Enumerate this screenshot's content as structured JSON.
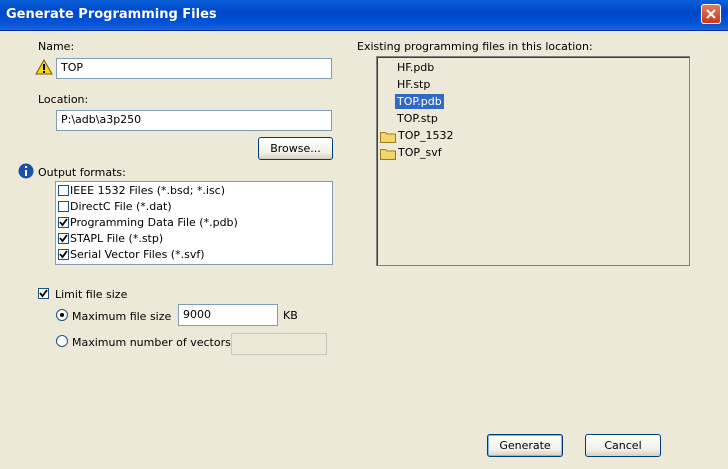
{
  "window": {
    "title": "Generate Programming Files"
  },
  "name": {
    "label": "Name:",
    "value": "TOP"
  },
  "location": {
    "label": "Location:",
    "value": "P:\\adb\\a3p250"
  },
  "browse_label": "Browse...",
  "output": {
    "label": "Output formats:",
    "items": [
      {
        "label": "IEEE 1532 Files (*.bsd; *.isc)",
        "checked": false
      },
      {
        "label": "DirectC File (*.dat)",
        "checked": false
      },
      {
        "label": "Programming Data File (*.pdb)",
        "checked": true
      },
      {
        "label": "STAPL File (*.stp)",
        "checked": true
      },
      {
        "label": "Serial Vector Files (*.svf)",
        "checked": true
      }
    ]
  },
  "existing": {
    "label": "Existing programming files in this location:",
    "items": [
      {
        "label": "HF.pdb",
        "type": "file",
        "selected": false
      },
      {
        "label": "HF.stp",
        "type": "file",
        "selected": false
      },
      {
        "label": "TOP.pdb",
        "type": "file",
        "selected": true
      },
      {
        "label": "TOP.stp",
        "type": "file",
        "selected": false
      },
      {
        "label": "TOP_1532",
        "type": "folder",
        "selected": false
      },
      {
        "label": "TOP_svf",
        "type": "folder",
        "selected": false
      }
    ]
  },
  "limit": {
    "label": "Limit file size",
    "checked": true,
    "max_size_label": "Maximum file size",
    "max_size_value": "9000",
    "max_size_unit": "KB",
    "max_vectors_label": "Maximum number of vectors",
    "max_vectors_value": "",
    "selected": "max_size"
  },
  "buttons": {
    "generate": "Generate",
    "cancel": "Cancel"
  },
  "colors": {
    "titlebar": "#0054e3",
    "selection": "#316ac5",
    "dialog": "#ece9d8"
  }
}
